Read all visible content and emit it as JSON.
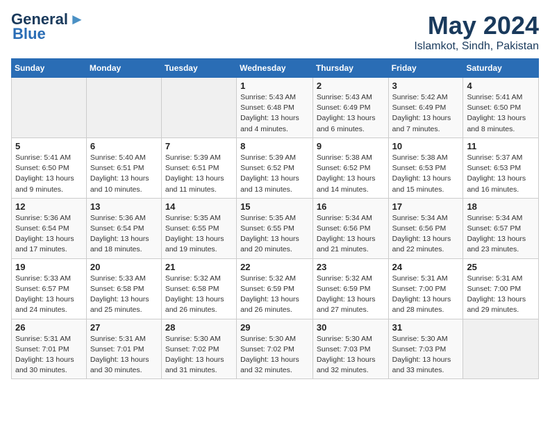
{
  "header": {
    "logo_line1": "General",
    "logo_line2": "Blue",
    "title": "May 2024",
    "subtitle": "Islamkot, Sindh, Pakistan"
  },
  "weekdays": [
    "Sunday",
    "Monday",
    "Tuesday",
    "Wednesday",
    "Thursday",
    "Friday",
    "Saturday"
  ],
  "weeks": [
    [
      {
        "day": "",
        "sunrise": "",
        "sunset": "",
        "daylight": ""
      },
      {
        "day": "",
        "sunrise": "",
        "sunset": "",
        "daylight": ""
      },
      {
        "day": "",
        "sunrise": "",
        "sunset": "",
        "daylight": ""
      },
      {
        "day": "1",
        "sunrise": "5:43 AM",
        "sunset": "6:48 PM",
        "daylight": "13 hours and 4 minutes."
      },
      {
        "day": "2",
        "sunrise": "5:43 AM",
        "sunset": "6:49 PM",
        "daylight": "13 hours and 6 minutes."
      },
      {
        "day": "3",
        "sunrise": "5:42 AM",
        "sunset": "6:49 PM",
        "daylight": "13 hours and 7 minutes."
      },
      {
        "day": "4",
        "sunrise": "5:41 AM",
        "sunset": "6:50 PM",
        "daylight": "13 hours and 8 minutes."
      }
    ],
    [
      {
        "day": "5",
        "sunrise": "5:41 AM",
        "sunset": "6:50 PM",
        "daylight": "13 hours and 9 minutes."
      },
      {
        "day": "6",
        "sunrise": "5:40 AM",
        "sunset": "6:51 PM",
        "daylight": "13 hours and 10 minutes."
      },
      {
        "day": "7",
        "sunrise": "5:39 AM",
        "sunset": "6:51 PM",
        "daylight": "13 hours and 11 minutes."
      },
      {
        "day": "8",
        "sunrise": "5:39 AM",
        "sunset": "6:52 PM",
        "daylight": "13 hours and 13 minutes."
      },
      {
        "day": "9",
        "sunrise": "5:38 AM",
        "sunset": "6:52 PM",
        "daylight": "13 hours and 14 minutes."
      },
      {
        "day": "10",
        "sunrise": "5:38 AM",
        "sunset": "6:53 PM",
        "daylight": "13 hours and 15 minutes."
      },
      {
        "day": "11",
        "sunrise": "5:37 AM",
        "sunset": "6:53 PM",
        "daylight": "13 hours and 16 minutes."
      }
    ],
    [
      {
        "day": "12",
        "sunrise": "5:36 AM",
        "sunset": "6:54 PM",
        "daylight": "13 hours and 17 minutes."
      },
      {
        "day": "13",
        "sunrise": "5:36 AM",
        "sunset": "6:54 PM",
        "daylight": "13 hours and 18 minutes."
      },
      {
        "day": "14",
        "sunrise": "5:35 AM",
        "sunset": "6:55 PM",
        "daylight": "13 hours and 19 minutes."
      },
      {
        "day": "15",
        "sunrise": "5:35 AM",
        "sunset": "6:55 PM",
        "daylight": "13 hours and 20 minutes."
      },
      {
        "day": "16",
        "sunrise": "5:34 AM",
        "sunset": "6:56 PM",
        "daylight": "13 hours and 21 minutes."
      },
      {
        "day": "17",
        "sunrise": "5:34 AM",
        "sunset": "6:56 PM",
        "daylight": "13 hours and 22 minutes."
      },
      {
        "day": "18",
        "sunrise": "5:34 AM",
        "sunset": "6:57 PM",
        "daylight": "13 hours and 23 minutes."
      }
    ],
    [
      {
        "day": "19",
        "sunrise": "5:33 AM",
        "sunset": "6:57 PM",
        "daylight": "13 hours and 24 minutes."
      },
      {
        "day": "20",
        "sunrise": "5:33 AM",
        "sunset": "6:58 PM",
        "daylight": "13 hours and 25 minutes."
      },
      {
        "day": "21",
        "sunrise": "5:32 AM",
        "sunset": "6:58 PM",
        "daylight": "13 hours and 26 minutes."
      },
      {
        "day": "22",
        "sunrise": "5:32 AM",
        "sunset": "6:59 PM",
        "daylight": "13 hours and 26 minutes."
      },
      {
        "day": "23",
        "sunrise": "5:32 AM",
        "sunset": "6:59 PM",
        "daylight": "13 hours and 27 minutes."
      },
      {
        "day": "24",
        "sunrise": "5:31 AM",
        "sunset": "7:00 PM",
        "daylight": "13 hours and 28 minutes."
      },
      {
        "day": "25",
        "sunrise": "5:31 AM",
        "sunset": "7:00 PM",
        "daylight": "13 hours and 29 minutes."
      }
    ],
    [
      {
        "day": "26",
        "sunrise": "5:31 AM",
        "sunset": "7:01 PM",
        "daylight": "13 hours and 30 minutes."
      },
      {
        "day": "27",
        "sunrise": "5:31 AM",
        "sunset": "7:01 PM",
        "daylight": "13 hours and 30 minutes."
      },
      {
        "day": "28",
        "sunrise": "5:30 AM",
        "sunset": "7:02 PM",
        "daylight": "13 hours and 31 minutes."
      },
      {
        "day": "29",
        "sunrise": "5:30 AM",
        "sunset": "7:02 PM",
        "daylight": "13 hours and 32 minutes."
      },
      {
        "day": "30",
        "sunrise": "5:30 AM",
        "sunset": "7:03 PM",
        "daylight": "13 hours and 32 minutes."
      },
      {
        "day": "31",
        "sunrise": "5:30 AM",
        "sunset": "7:03 PM",
        "daylight": "13 hours and 33 minutes."
      },
      {
        "day": "",
        "sunrise": "",
        "sunset": "",
        "daylight": ""
      }
    ]
  ],
  "labels": {
    "sunrise_prefix": "Sunrise: ",
    "sunset_prefix": "Sunset: ",
    "daylight_prefix": "Daylight: "
  }
}
